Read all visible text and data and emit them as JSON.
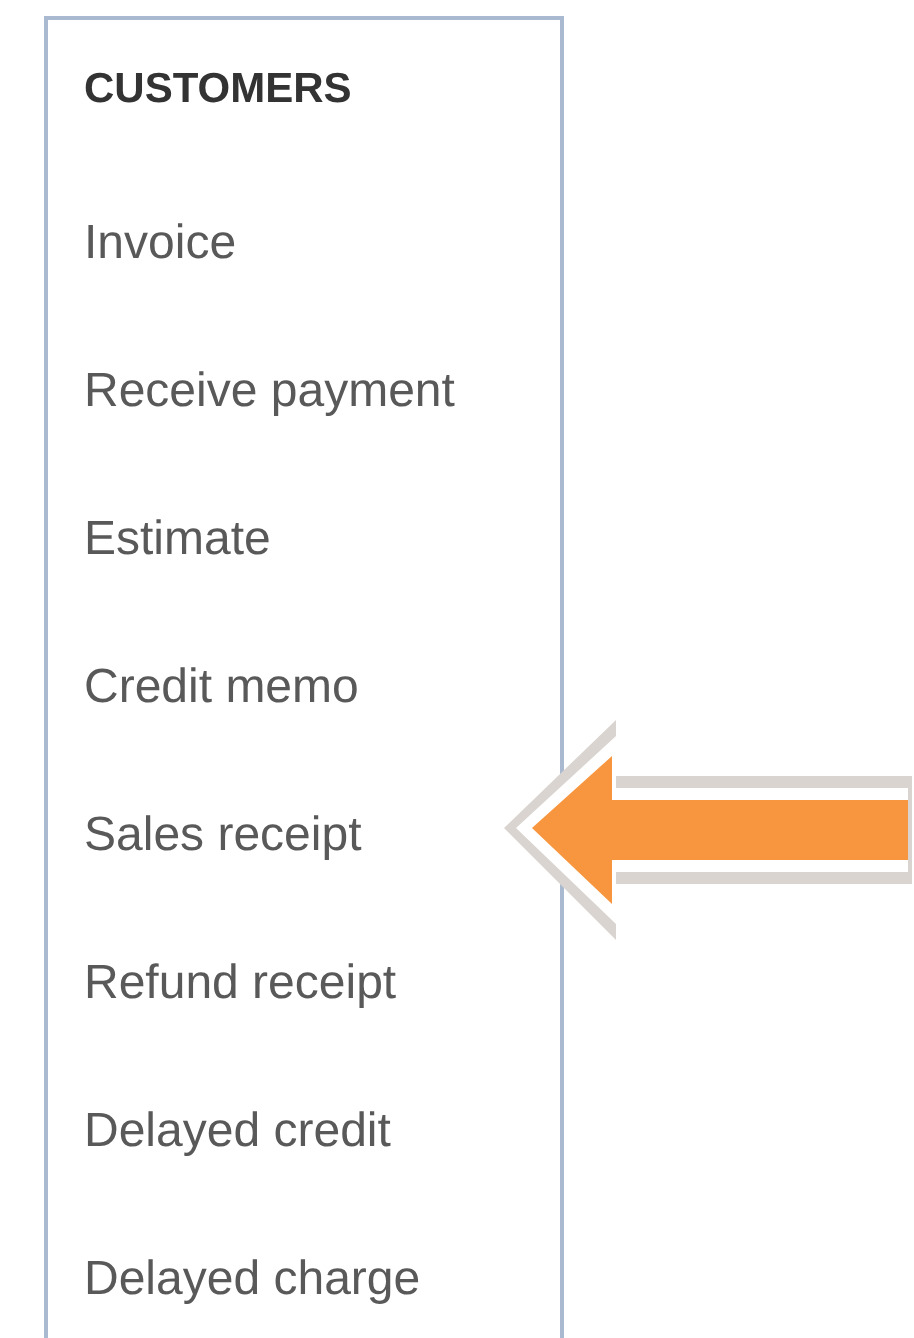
{
  "menu": {
    "title": "CUSTOMERS",
    "items": [
      {
        "label": "Invoice"
      },
      {
        "label": "Receive payment"
      },
      {
        "label": "Estimate"
      },
      {
        "label": "Credit memo"
      },
      {
        "label": "Sales receipt"
      },
      {
        "label": "Refund receipt"
      },
      {
        "label": "Delayed credit"
      },
      {
        "label": "Delayed charge"
      }
    ]
  }
}
